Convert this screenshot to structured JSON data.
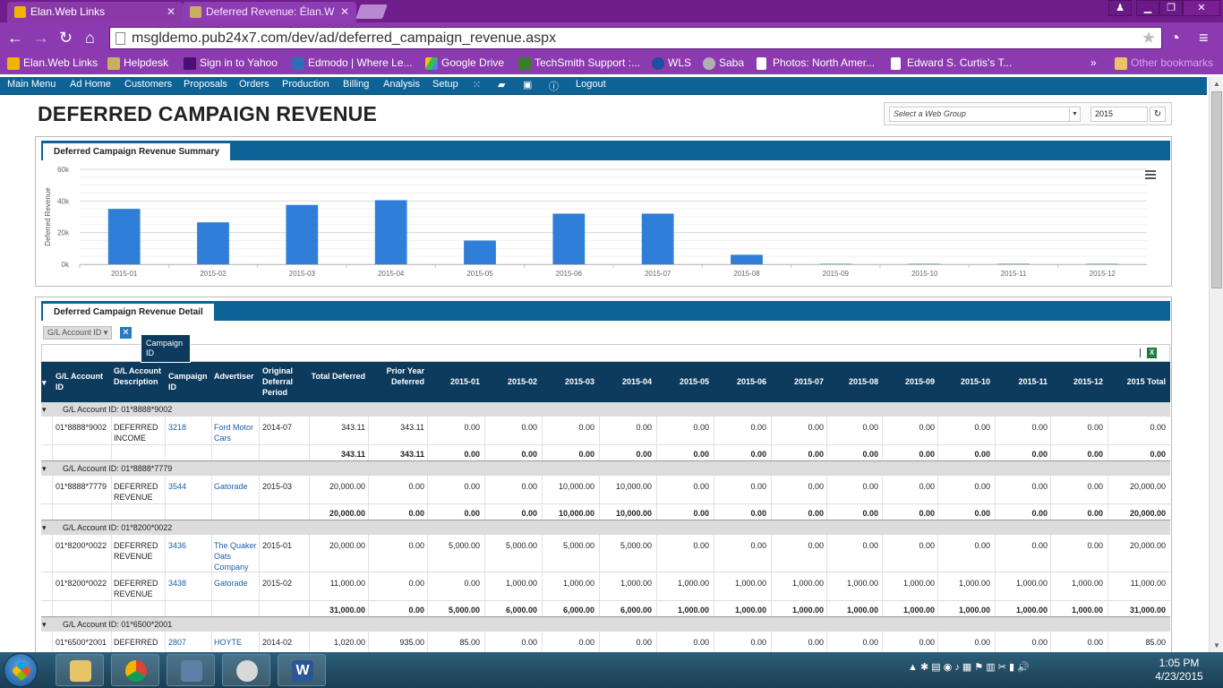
{
  "browser": {
    "tabs": [
      {
        "title": "Elan.Web Links",
        "active": false
      },
      {
        "title": "Deferred Revenue: Élan.W",
        "active": true
      }
    ],
    "url": "msgldemo.pub24x7.com/dev/ad/deferred_campaign_revenue.aspx",
    "bookmarks": [
      "Elan.Web Links",
      "Helpdesk",
      "Sign in to Yahoo",
      "Edmodo | Where Le...",
      "Google Drive",
      "TechSmith Support :...",
      "WLS",
      "Saba",
      "Photos: North Amer...",
      "Edward S. Curtis's T..."
    ],
    "bookmarks_overflow": "»",
    "other_bookmarks": "Other bookmarks"
  },
  "nav": {
    "items": [
      "Main Menu",
      "Ad Home",
      "Customers",
      "Proposals",
      "Orders",
      "Production",
      "Billing",
      "Analysis",
      "Setup"
    ],
    "icons": [
      "grid-icon",
      "chat-icon",
      "calendar-icon",
      "info-icon"
    ],
    "logout": "Logout"
  },
  "page": {
    "title": "DEFERRED CAMPAIGN REVENUE",
    "web_group_placeholder": "Select a Web Group",
    "year": "2015"
  },
  "summary": {
    "tab_label": "Deferred Campaign Revenue Summary"
  },
  "chart_data": {
    "type": "bar",
    "title": "",
    "ylabel": "Deferred Revenue",
    "xlabel": "",
    "categories": [
      "2015-01",
      "2015-02",
      "2015-03",
      "2015-04",
      "2015-05",
      "2015-06",
      "2015-07",
      "2015-08",
      "2015-09",
      "2015-10",
      "2015-11",
      "2015-12"
    ],
    "values": [
      35000,
      26500,
      37500,
      40500,
      15000,
      32000,
      32000,
      6000,
      300,
      300,
      300,
      300
    ],
    "yticks": [
      "0k",
      "20k",
      "40k",
      "60k"
    ],
    "ylim": [
      0,
      60000
    ],
    "bar_color": "#2f7ed8",
    "grid": true
  },
  "detail": {
    "tab_label": "Deferred Campaign Revenue Detail",
    "group_chip": "G/L Account ID",
    "drag_tip": "Campaign ID",
    "excel_icon": "X",
    "columns": [
      "G/L Account ID",
      "G/L Account Description",
      "Campaign ID",
      "Advertiser",
      "Original Deferral Period",
      "Total Deferred",
      "Prior Year Deferred",
      "2015-01",
      "2015-02",
      "2015-03",
      "2015-04",
      "2015-05",
      "2015-06",
      "2015-07",
      "2015-08",
      "2015-09",
      "2015-10",
      "2015-11",
      "2015-12",
      "2015 Total"
    ],
    "groups": [
      {
        "label": "G/L Account ID: 01*8888*9002",
        "rows": [
          {
            "gl": "01*8888*9002",
            "desc": "DEFERRED INCOME",
            "cid": "3218",
            "adv": "Ford Motor Cars",
            "period": "2014-07",
            "vals": [
              "343.11",
              "343.11",
              "0.00",
              "0.00",
              "0.00",
              "0.00",
              "0.00",
              "0.00",
              "0.00",
              "0.00",
              "0.00",
              "0.00",
              "0.00",
              "0.00",
              "0.00"
            ]
          }
        ],
        "totals": [
          "343.11",
          "343.11",
          "0.00",
          "0.00",
          "0.00",
          "0.00",
          "0.00",
          "0.00",
          "0.00",
          "0.00",
          "0.00",
          "0.00",
          "0.00",
          "0.00",
          "0.00"
        ]
      },
      {
        "label": "G/L Account ID: 01*8888*7779",
        "rows": [
          {
            "gl": "01*8888*7779",
            "desc": "DEFERRED REVENUE",
            "cid": "3544",
            "adv": "Gatorade",
            "period": "2015-03",
            "vals": [
              "20,000.00",
              "0.00",
              "0.00",
              "0.00",
              "10,000.00",
              "10,000.00",
              "0.00",
              "0.00",
              "0.00",
              "0.00",
              "0.00",
              "0.00",
              "0.00",
              "0.00",
              "20,000.00"
            ]
          }
        ],
        "totals": [
          "20,000.00",
          "0.00",
          "0.00",
          "0.00",
          "10,000.00",
          "10,000.00",
          "0.00",
          "0.00",
          "0.00",
          "0.00",
          "0.00",
          "0.00",
          "0.00",
          "0.00",
          "20,000.00"
        ]
      },
      {
        "label": "G/L Account ID: 01*8200*0022",
        "rows": [
          {
            "gl": "01*8200*0022",
            "desc": "DEFERRED REVENUE",
            "cid": "3436",
            "adv": "The Quaker Oats Company",
            "period": "2015-01",
            "vals": [
              "20,000.00",
              "0.00",
              "5,000.00",
              "5,000.00",
              "5,000.00",
              "5,000.00",
              "0.00",
              "0.00",
              "0.00",
              "0.00",
              "0.00",
              "0.00",
              "0.00",
              "0.00",
              "20,000.00"
            ]
          },
          {
            "gl": "01*8200*0022",
            "desc": "DEFERRED REVENUE",
            "cid": "3438",
            "adv": "Gatorade",
            "period": "2015-02",
            "vals": [
              "11,000.00",
              "0.00",
              "0.00",
              "1,000.00",
              "1,000.00",
              "1,000.00",
              "1,000.00",
              "1,000.00",
              "1,000.00",
              "1,000.00",
              "1,000.00",
              "1,000.00",
              "1,000.00",
              "1,000.00",
              "11,000.00"
            ]
          }
        ],
        "totals": [
          "31,000.00",
          "0.00",
          "5,000.00",
          "6,000.00",
          "6,000.00",
          "6,000.00",
          "1,000.00",
          "1,000.00",
          "1,000.00",
          "1,000.00",
          "1,000.00",
          "1,000.00",
          "1,000.00",
          "1,000.00",
          "31,000.00"
        ]
      },
      {
        "label": "G/L Account ID: 01*6500*2001",
        "rows": [
          {
            "gl": "01*6500*2001",
            "desc": "DEFERRED",
            "cid": "2807",
            "adv": "HOYTE",
            "period": "2014-02",
            "vals": [
              "1,020.00",
              "935.00",
              "85.00",
              "0.00",
              "0.00",
              "0.00",
              "0.00",
              "0.00",
              "0.00",
              "0.00",
              "0.00",
              "0.00",
              "0.00",
              "0.00",
              "85.00"
            ]
          }
        ],
        "totals": []
      }
    ]
  },
  "taskbar": {
    "time": "1:05 PM",
    "date": "4/23/2015"
  }
}
